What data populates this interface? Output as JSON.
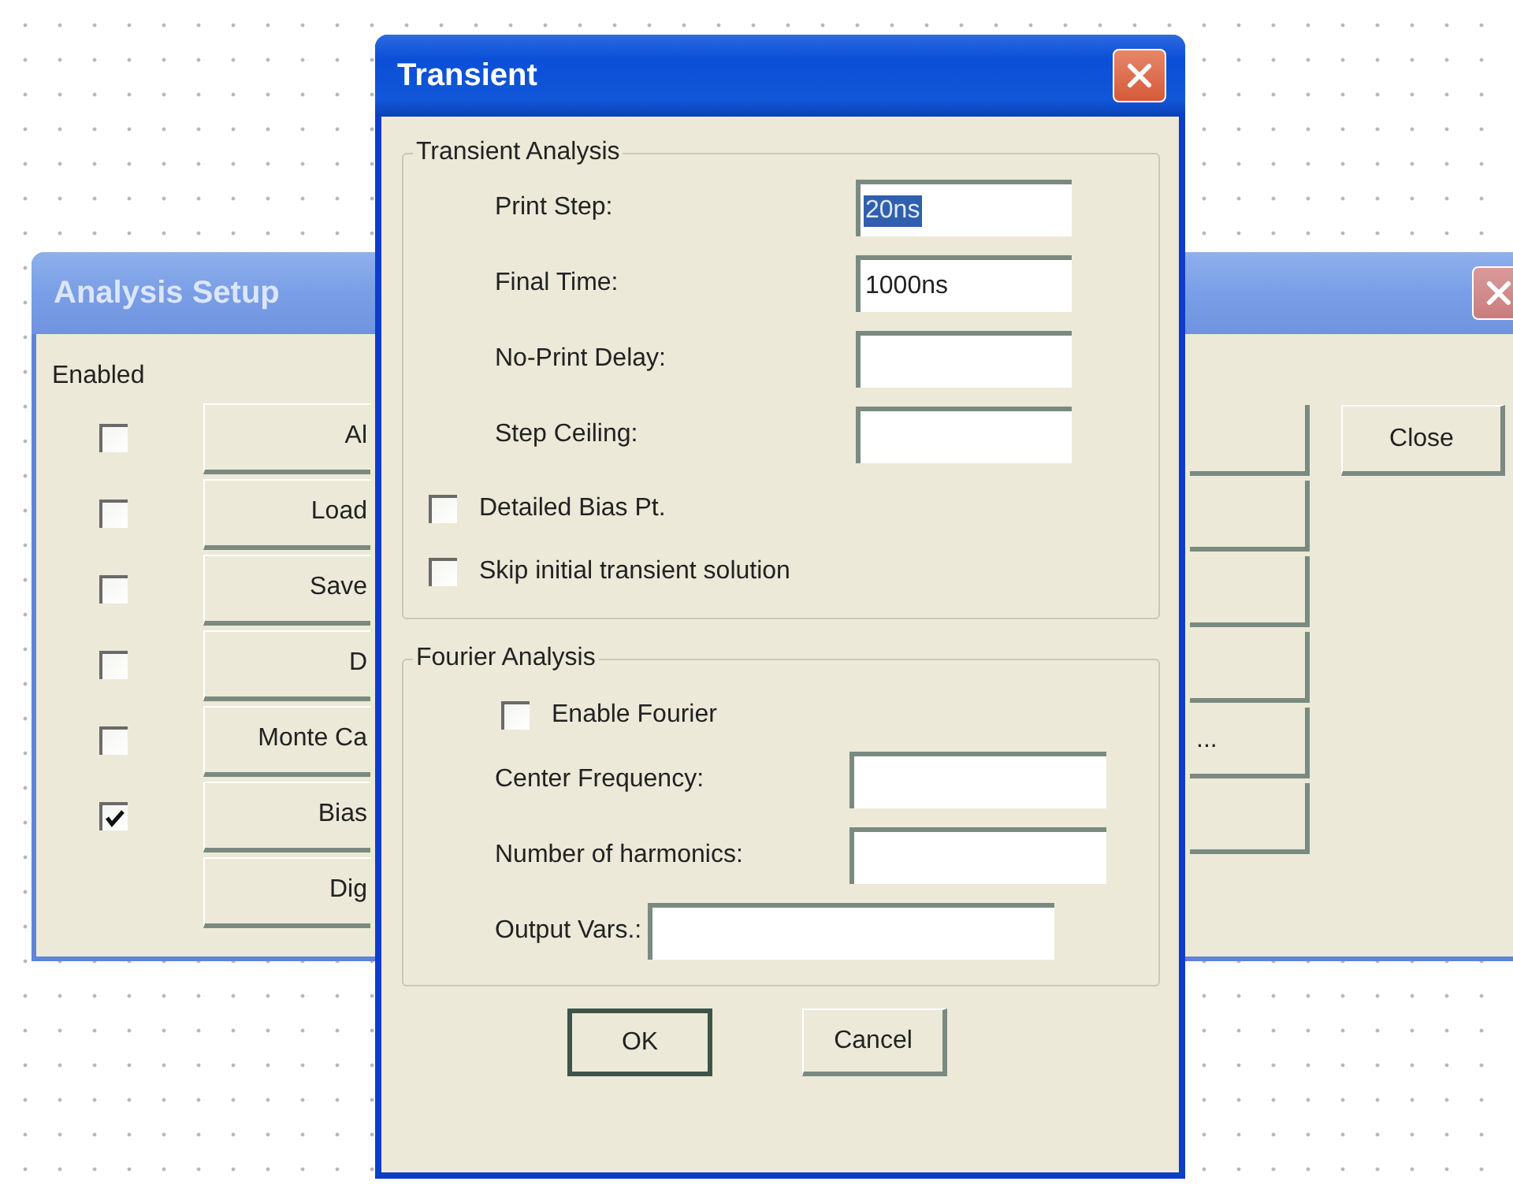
{
  "analysis_setup": {
    "title": "Analysis Setup",
    "enabled_label": "Enabled",
    "rows": [
      {
        "kind": "toggle",
        "enabled": false,
        "label": "Al"
      },
      {
        "kind": "toggle",
        "enabled": false,
        "label": "Load"
      },
      {
        "kind": "toggle",
        "enabled": false,
        "label": "Save"
      },
      {
        "kind": "toggle",
        "enabled": false,
        "label": "D"
      },
      {
        "kind": "toggle",
        "enabled": false,
        "label": "Monte Ca",
        "right_label": "..."
      },
      {
        "kind": "toggle",
        "enabled": true,
        "label": "Bias"
      },
      {
        "kind": "plain",
        "label": "Dig"
      }
    ],
    "close_button": "Close"
  },
  "transient": {
    "title": "Transient",
    "transient_analysis": {
      "title": "Transient Analysis",
      "fields": [
        {
          "label": "Print Step:",
          "value": "20ns",
          "highlighted": true
        },
        {
          "label": "Final Time:",
          "value": "1000ns",
          "highlighted": false
        },
        {
          "label": "No-Print Delay:"
        },
        {
          "label": "Step Ceiling:"
        }
      ],
      "options": [
        {
          "label": "Detailed Bias Pt.",
          "checked": false
        },
        {
          "label": "Skip initial transient solution",
          "checked": false
        }
      ]
    },
    "fourier_analysis": {
      "title": "Fourier Analysis",
      "enable": {
        "label": "Enable Fourier",
        "checked": false
      },
      "fields": [
        {
          "kind": "standard",
          "label": "Center Frequency:"
        },
        {
          "kind": "standard",
          "label": "Number of harmonics:"
        },
        {
          "kind": "wide",
          "label": "Output Vars.:"
        }
      ]
    },
    "buttons": [
      {
        "label": "OK",
        "default": true
      },
      {
        "label": "Cancel",
        "default": false
      }
    ]
  }
}
